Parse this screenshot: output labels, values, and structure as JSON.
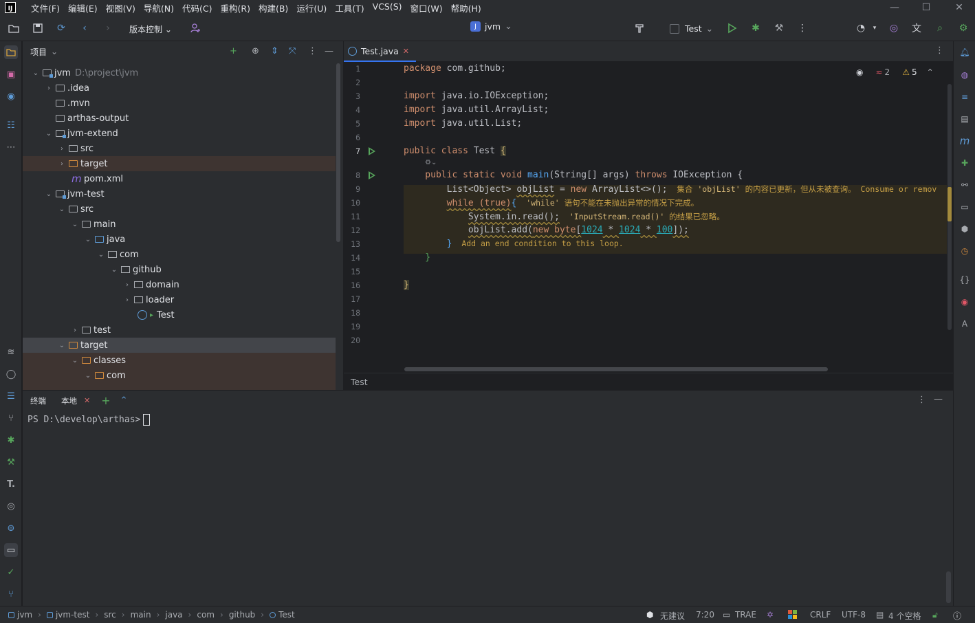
{
  "menubar": {
    "logo": "IJ",
    "items": [
      "文件(F)",
      "编辑(E)",
      "视图(V)",
      "导航(N)",
      "代码(C)",
      "重构(R)",
      "构建(B)",
      "运行(U)",
      "工具(T)",
      "VCS(S)",
      "窗口(W)",
      "帮助(H)"
    ]
  },
  "toolbar": {
    "vcs_label": "版本控制",
    "project_badge": "J",
    "project_name": "jvm",
    "run_config": "Test"
  },
  "project_panel": {
    "title": "项目",
    "tree": [
      {
        "label": "jvm",
        "path": "D:\\project\\jvm"
      },
      {
        "label": ".idea"
      },
      {
        "label": ".mvn"
      },
      {
        "label": "arthas-output"
      },
      {
        "label": "jvm-extend"
      },
      {
        "label": "src"
      },
      {
        "label": "target"
      },
      {
        "label": "pom.xml"
      },
      {
        "label": "jvm-test"
      },
      {
        "label": "src"
      },
      {
        "label": "main"
      },
      {
        "label": "java"
      },
      {
        "label": "com"
      },
      {
        "label": "github"
      },
      {
        "label": "domain"
      },
      {
        "label": "loader"
      },
      {
        "label": "Test"
      },
      {
        "label": "test"
      },
      {
        "label": "target"
      },
      {
        "label": "classes"
      },
      {
        "label": "com"
      }
    ]
  },
  "editor": {
    "tab_label": "Test.java",
    "line_numbers": [
      "1",
      "2",
      "3",
      "4",
      "5",
      "6",
      "7",
      "8",
      "9",
      "10",
      "11",
      "12",
      "13",
      "14",
      "15",
      "16",
      "17",
      "18",
      "19",
      "20"
    ],
    "inspections": {
      "errors": "2",
      "warnings": "5"
    },
    "code": {
      "l1a": "package",
      "l1b": " com.github;",
      "l3a": "import",
      "l3b": " java.io.IOException;",
      "l4a": "import",
      "l4b": " java.util.ArrayList;",
      "l5a": "import",
      "l5b": " java.util.List;",
      "l7a": "public class",
      "l7b": " Test ",
      "l7c": "{",
      "l8a": "    public static void ",
      "l8b": "main",
      "l8c": "(String[] args) ",
      "l8d": "throws",
      "l8e": " IOException {",
      "l9a": "        List<Object> ",
      "l9b": "objList",
      "l9c": " = ",
      "l9d": "new",
      "l9e": " ArrayList<>();",
      "l10a": "        ",
      "l10b": "while (true)",
      "l10c": "{",
      "l11a": "            ",
      "l11b": "System.in.read();",
      "l12a": "            ",
      "l12b": "objList.add(",
      "l12c": "new byte",
      "l12d": "[",
      "l12e": "1024",
      "l12f": " * ",
      "l12g": "1024",
      "l12h": " * ",
      "l12i": "100",
      "l12j": "]);",
      "l13a": "        ",
      "l13b": "}",
      "l14": "    }",
      "l16": "}"
    },
    "hints": {
      "l9_a": "集合 ",
      "l9_b": "'objList'",
      "l9_c": " 的内容已更新，但从未被查询。 ",
      "l9_d": "Consume or remov",
      "l10_a": "'while'",
      "l10_b": " 语句不能在未抛出异常的情况下完成。",
      "l11_a": "'InputStream.read()'",
      "l11_b": " 的结果已忽略。",
      "l13": "Add an end condition to this loop."
    },
    "breadcrumb": "Test"
  },
  "terminal": {
    "title": "终端",
    "tab_label": "本地",
    "prompt": "PS D:\\develop\\arthas>"
  },
  "statusbar": {
    "crumbs": [
      "jvm",
      "jvm-test",
      "src",
      "main",
      "java",
      "com",
      "github",
      "Test"
    ],
    "suggestion": "无建议",
    "position": "7:20",
    "trae": "TRAE",
    "line_sep": "CRLF",
    "encoding": "UTF-8",
    "indent": "4 个空格"
  }
}
